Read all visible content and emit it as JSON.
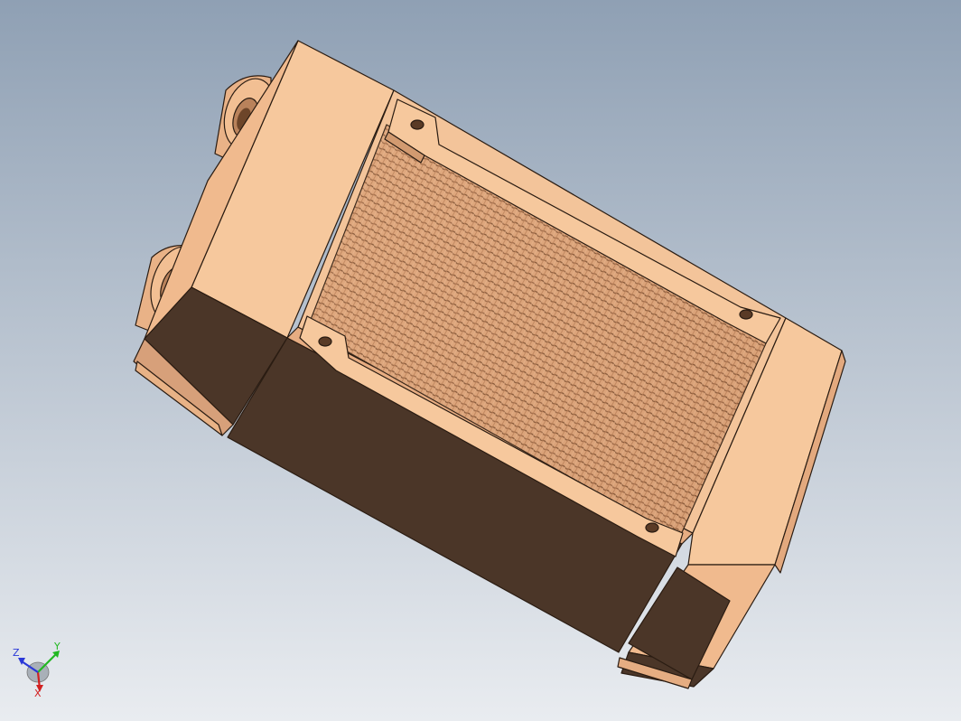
{
  "viewport": {
    "background_top": "#8fa0b4",
    "background_bottom": "#e9ecf0"
  },
  "model": {
    "body_light": "#f6c89d",
    "body_mid": "#f0b98c",
    "body_edge": "#c98e62",
    "body_dark": "#4b3628",
    "fin_light": "#e9b288",
    "fin_dark": "#8b5b3c",
    "outline": "#2a1c12"
  },
  "triad": {
    "x_label": "X",
    "y_label": "Y",
    "z_label": "Z",
    "x_color": "#d22020",
    "y_color": "#22b822",
    "z_color": "#2a38d8"
  }
}
